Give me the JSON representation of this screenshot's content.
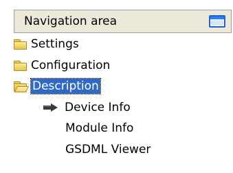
{
  "panel": {
    "title": "Navigation area",
    "maximize_icon": "window-maximize-icon"
  },
  "tree": {
    "items": [
      {
        "label": "Settings",
        "icon": "folder-closed-icon",
        "selected": false
      },
      {
        "label": "Configuration",
        "icon": "folder-closed-icon",
        "selected": false
      },
      {
        "label": "Description",
        "icon": "folder-open-icon",
        "selected": true
      },
      {
        "label": "Device Info",
        "icon": "arrow-right-icon",
        "current": true
      },
      {
        "label": "Module Info",
        "icon": null
      },
      {
        "label": "GSDML Viewer",
        "icon": null
      }
    ]
  },
  "colors": {
    "selection_bg": "#316ac5",
    "header_bg": "#ece9d8",
    "folder_yellow": "#e7c84a"
  }
}
